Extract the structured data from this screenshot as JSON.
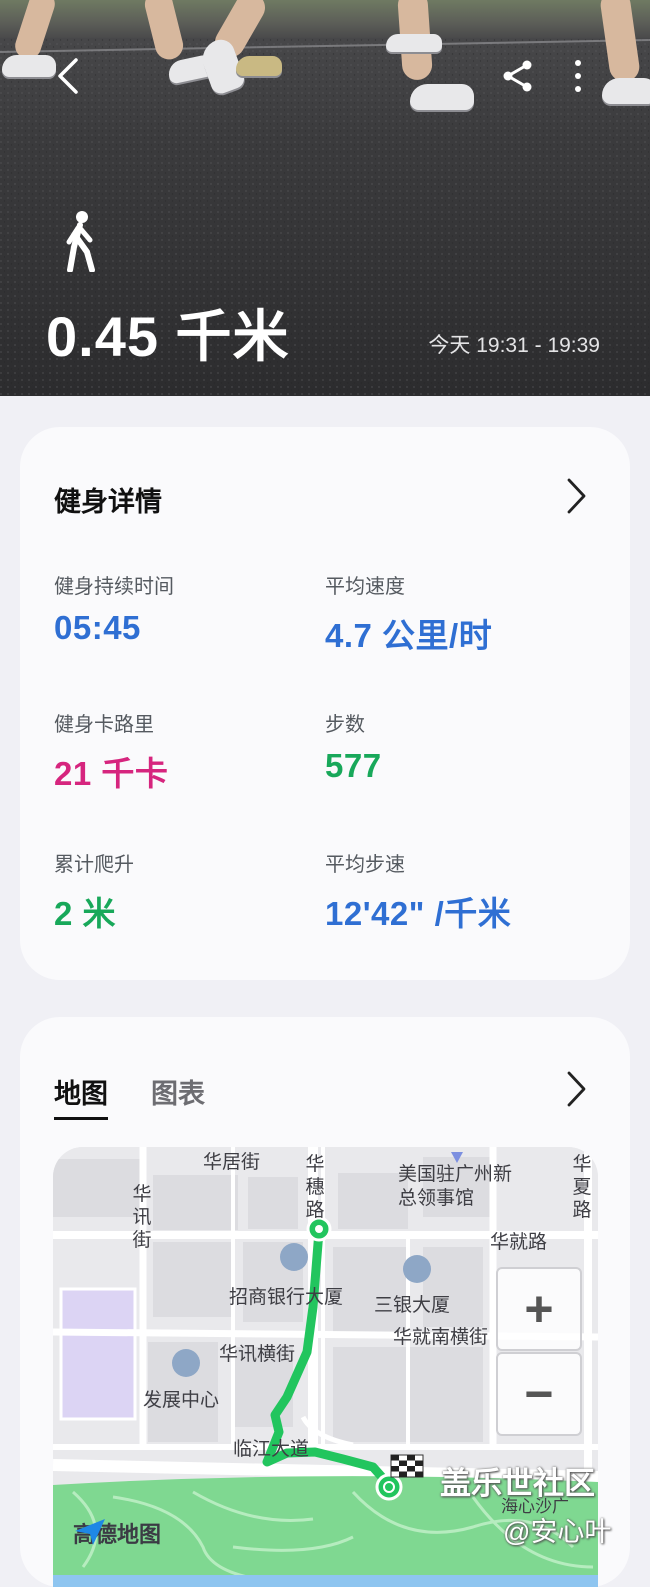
{
  "hero": {
    "back_icon": "chevron-left-icon",
    "share_icon": "share-icon",
    "more_icon": "more-vertical-icon",
    "activity_icon": "walking-icon",
    "distance": "0.45 千米",
    "time_range": "今天 19:31 - 19:39"
  },
  "details": {
    "title": "健身详情",
    "stats": [
      {
        "label": "健身持续时间",
        "value": "05:45",
        "color": "#2f6fd3"
      },
      {
        "label": "平均速度",
        "value": "4.7 公里/时",
        "color": "#2f6fd3"
      },
      {
        "label": "健身卡路里",
        "value": "21 千卡",
        "color": "#d6257e"
      },
      {
        "label": "步数",
        "value": "577",
        "color": "#18a85a"
      },
      {
        "label": "累计爬升",
        "value": "2 米",
        "color": "#18a85a"
      },
      {
        "label": "平均步速",
        "value": "12'42\" /千米",
        "color": "#2f6fd3"
      }
    ]
  },
  "map_section": {
    "tabs": [
      {
        "label": "地图",
        "active": true
      },
      {
        "label": "图表",
        "active": false
      }
    ],
    "map_labels": {
      "huaju": "华居街",
      "suihua": "华穗路",
      "us_consulate": "美国驻广州新总领事馆",
      "huaxia": "华夏路",
      "huaxun": "华讯街",
      "huajiu": "华就路",
      "zhaoshang": "招商银行大厦",
      "sanyin": "三银大厦",
      "huajiu_south": "华就南横街",
      "huaxun_heng": "华讯横街",
      "fazhan": "发展中心",
      "linjiang": "临江大道",
      "park": "海心沙广"
    },
    "zoom_in": "+",
    "zoom_out": "−",
    "provider": "高德地图",
    "route_color": "#22c55e"
  },
  "watermark": {
    "line1": "盖乐世社区",
    "line2": "@安心叶"
  }
}
